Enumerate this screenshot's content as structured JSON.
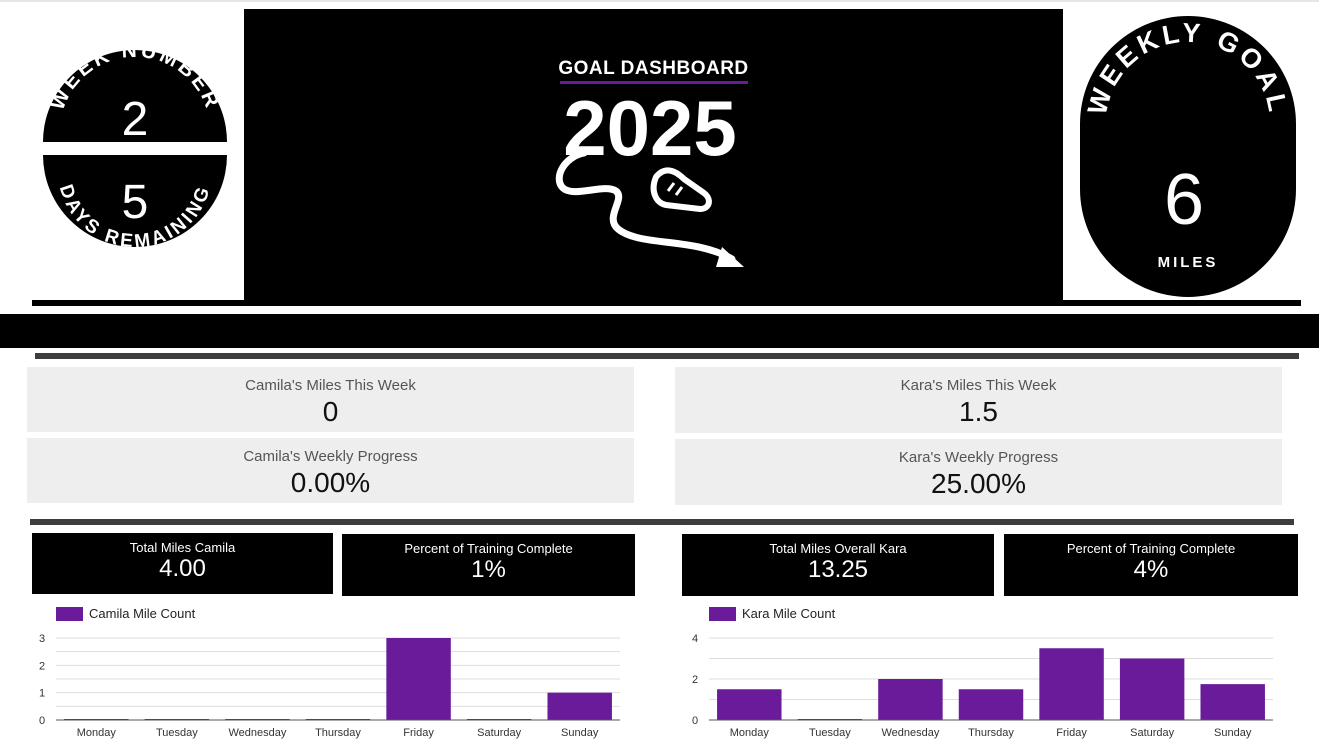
{
  "colors": {
    "accent": "#6a1b9a",
    "black": "#000000",
    "card_bg": "#eeeeee"
  },
  "week_badge": {
    "top_text": "WEEK NUMBER",
    "week_number": "2",
    "days_number": "5",
    "bottom_text": "DAYS REMAINING"
  },
  "hero": {
    "title": "GOAL DASHBOARD",
    "year": "2025",
    "icon": "running-shoe-path-icon"
  },
  "goal_badge": {
    "top_text": "WEEKLY GOAL",
    "value": "6",
    "unit": "MILES"
  },
  "camila": {
    "miles_week_label": "Camila's Miles This Week",
    "miles_week_value": "0",
    "progress_label": "Camila's Weekly Progress",
    "progress_value": "0.00%",
    "total_label": "Total Miles Camila",
    "total_value": "4.00",
    "training_label": "Percent of Training Complete",
    "training_value": "1%"
  },
  "kara": {
    "miles_week_label": "Kara's Miles This Week",
    "miles_week_value": "1.5",
    "progress_label": "Kara's Weekly Progress",
    "progress_value": "25.00%",
    "total_label": "Total Miles Overall Kara",
    "total_value": "13.25",
    "training_label": "Percent of Training Complete",
    "training_value": "4%"
  },
  "chart_data": [
    {
      "type": "bar",
      "categories": [
        "Monday",
        "Tuesday",
        "Wednesday",
        "Thursday",
        "Friday",
        "Saturday",
        "Sunday"
      ],
      "series": [
        {
          "name": "Camila Mile Count",
          "values": [
            0,
            0,
            0,
            0,
            3,
            0,
            1
          ]
        }
      ],
      "yticks": [
        0,
        1,
        2,
        3
      ],
      "ylim": [
        0,
        3
      ],
      "grid": true,
      "legend": "top-left"
    },
    {
      "type": "bar",
      "categories": [
        "Monday",
        "Tuesday",
        "Wednesday",
        "Thursday",
        "Friday",
        "Saturday",
        "Sunday"
      ],
      "series": [
        {
          "name": "Kara Mile Count",
          "values": [
            1.5,
            0,
            2,
            1.5,
            3.5,
            3,
            1.75
          ]
        }
      ],
      "yticks": [
        0,
        2,
        4
      ],
      "ylim": [
        0,
        4
      ],
      "grid": true,
      "legend": "top-left"
    }
  ]
}
